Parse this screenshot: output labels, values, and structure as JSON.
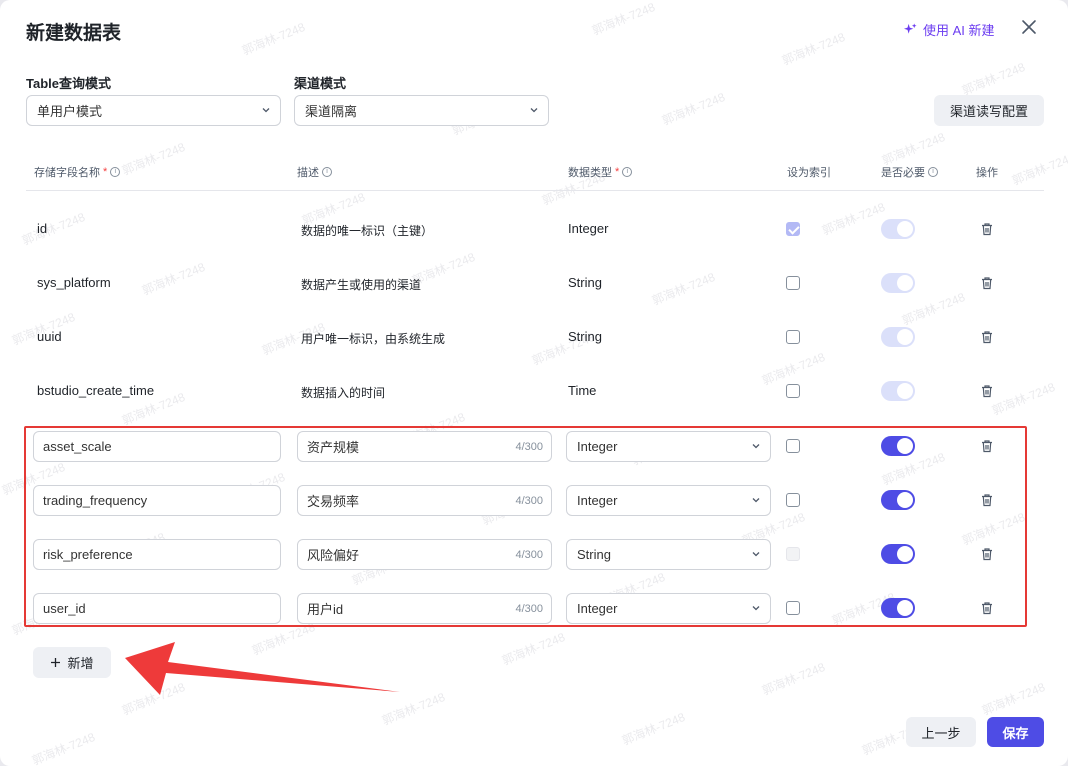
{
  "dialog": {
    "title": "新建数据表",
    "ai_button": "使用 AI 新建"
  },
  "config": {
    "table_mode_label": "Table查询模式",
    "table_mode_value": "单用户模式",
    "channel_mode_label": "渠道模式",
    "channel_mode_value": "渠道隔离",
    "channel_rw_button": "渠道读写配置"
  },
  "columns": {
    "field_name": "存储字段名称",
    "description": "描述",
    "data_type": "数据类型",
    "index": "设为索引",
    "required": "是否必要",
    "actions": "操作",
    "required_mark": "*"
  },
  "system_rows": [
    {
      "name": "id",
      "desc": "数据的唯一标识（主键）",
      "type": "Integer",
      "index": "checked",
      "required": "off"
    },
    {
      "name": "sys_platform",
      "desc": "数据产生或使用的渠道",
      "type": "String",
      "index": "unchecked",
      "required": "off"
    },
    {
      "name": "uuid",
      "desc": "用户唯一标识，由系统生成",
      "type": "String",
      "index": "unchecked",
      "required": "off"
    },
    {
      "name": "bstudio_create_time",
      "desc": "数据插入的时间",
      "type": "Time",
      "index": "unchecked",
      "required": "off"
    }
  ],
  "custom_rows": [
    {
      "name": "asset_scale",
      "desc": "资产规模",
      "count": "4/300",
      "type": "Integer",
      "index": "unchecked",
      "required": "on"
    },
    {
      "name": "trading_frequency",
      "desc": "交易频率",
      "count": "4/300",
      "type": "Integer",
      "index": "unchecked",
      "required": "on"
    },
    {
      "name": "risk_preference",
      "desc": "风险偏好",
      "count": "4/300",
      "type": "String",
      "index": "disabled",
      "required": "on"
    },
    {
      "name": "user_id",
      "desc": "用户id",
      "count": "4/300",
      "type": "Integer",
      "index": "unchecked",
      "required": "on"
    }
  ],
  "footer": {
    "add_button": "新增",
    "prev_button": "上一步",
    "save_button": "保存"
  },
  "watermark": "郭海林-7248",
  "colors": {
    "accent": "#4e4ce5",
    "ai_purple": "#6b3cf0",
    "highlight_red": "#e53935"
  }
}
